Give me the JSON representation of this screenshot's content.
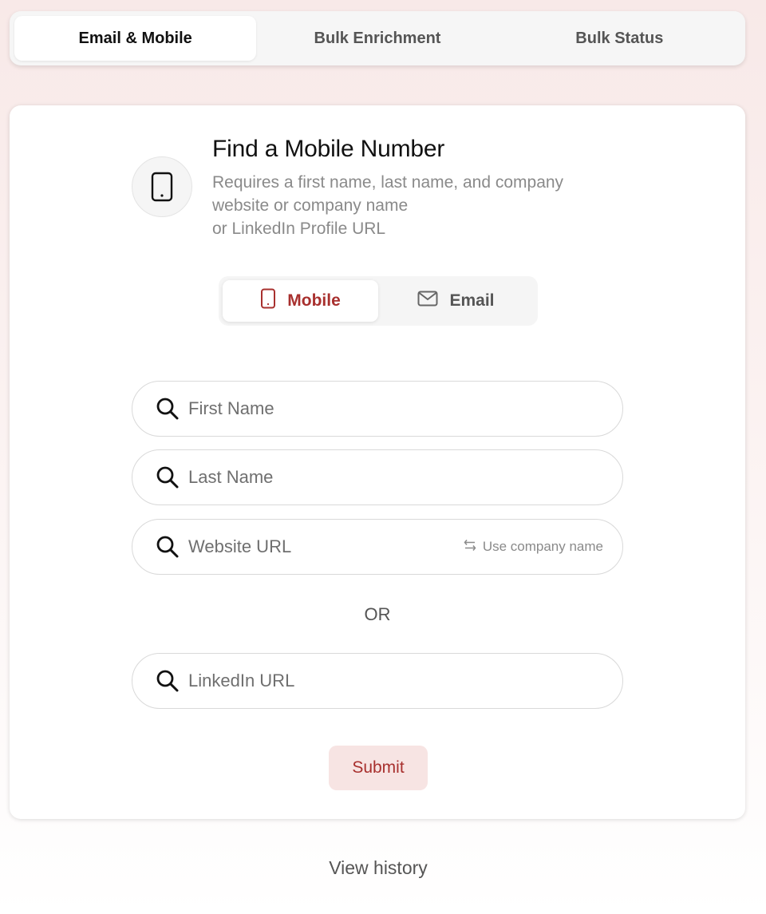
{
  "tabs": [
    {
      "label": "Email & Mobile",
      "active": true
    },
    {
      "label": "Bulk Enrichment",
      "active": false
    },
    {
      "label": "Bulk Status",
      "active": false
    }
  ],
  "header": {
    "icon": "mobile-phone-icon",
    "title": "Find a Mobile Number",
    "subtitle_lines": [
      "Requires a first name, last name, and company",
      "website or company name",
      "or LinkedIn Profile URL"
    ]
  },
  "mode_toggle": {
    "mobile": {
      "label": "Mobile",
      "icon": "mobile-phone-icon",
      "active": true
    },
    "email": {
      "label": "Email",
      "icon": "envelope-icon",
      "active": false
    }
  },
  "form": {
    "first_name": {
      "placeholder": "First Name",
      "value": "",
      "icon": "search-icon"
    },
    "last_name": {
      "placeholder": "Last Name",
      "value": "",
      "icon": "search-icon"
    },
    "website_url": {
      "placeholder": "Website URL",
      "value": "",
      "icon": "search-icon",
      "switch_label": "Use company name",
      "switch_icon": "swap-arrows-icon"
    },
    "or_label": "OR",
    "linkedin_url": {
      "placeholder": "LinkedIn URL",
      "value": "",
      "icon": "search-icon"
    },
    "submit_label": "Submit"
  },
  "footer": {
    "history_label": "View history"
  },
  "colors": {
    "accent": "#a8302e",
    "accent_bg": "#f7e4e3",
    "page_bg": "#f8e9e8"
  }
}
